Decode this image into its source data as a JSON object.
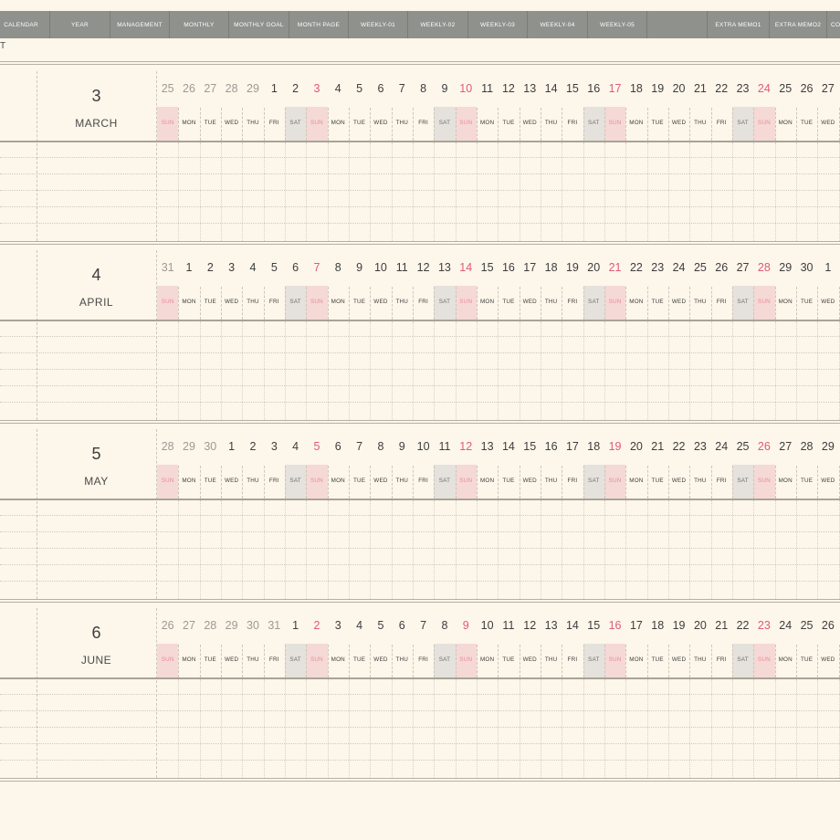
{
  "nav": {
    "tabs": [
      {
        "label": "CALENDAR"
      },
      {
        "label": "YEAR"
      },
      {
        "label": "MANAGEMENT"
      },
      {
        "label": "MONTHLY"
      },
      {
        "label": "MONTHLY GOAL"
      },
      {
        "label": "MONTH PAGE"
      },
      {
        "label": "WEEKLY-01"
      },
      {
        "label": "WEEKLY-02"
      },
      {
        "label": "WEEKLY-03"
      },
      {
        "label": "WEEKLY-04"
      },
      {
        "label": "WEEKLY-05"
      },
      {
        "label": ""
      },
      {
        "label": "EXTRA MEMO1"
      },
      {
        "label": "EXTRA MEMO2"
      },
      {
        "label": "CO"
      }
    ]
  },
  "page": {
    "title_fragment": "T"
  },
  "months": [
    {
      "number": "3",
      "name": "MARCH",
      "dates": [
        "25",
        "26",
        "27",
        "28",
        "29",
        "1",
        "2",
        "3",
        "4",
        "5",
        "6",
        "7",
        "8",
        "9",
        "10",
        "11",
        "12",
        "13",
        "14",
        "15",
        "16",
        "17",
        "18",
        "19",
        "20",
        "21",
        "22",
        "23",
        "24",
        "25",
        "26",
        "27"
      ],
      "weekdays": [
        "SUN",
        "MON",
        "TUE",
        "WED",
        "THU",
        "FRI",
        "SAT",
        "SUN",
        "MON",
        "TUE",
        "WED",
        "THU",
        "FRI",
        "SAT",
        "SUN",
        "MON",
        "TUE",
        "WED",
        "THU",
        "FRI",
        "SAT",
        "SUN",
        "MON",
        "TUE",
        "WED",
        "THU",
        "FRI",
        "SAT",
        "SUN",
        "MON",
        "TUE",
        "WED"
      ],
      "leading_other": 5
    },
    {
      "number": "4",
      "name": "APRIL",
      "dates": [
        "31",
        "1",
        "2",
        "3",
        "4",
        "5",
        "6",
        "7",
        "8",
        "9",
        "10",
        "11",
        "12",
        "13",
        "14",
        "15",
        "16",
        "17",
        "18",
        "19",
        "20",
        "21",
        "22",
        "23",
        "24",
        "25",
        "26",
        "27",
        "28",
        "29",
        "30",
        "1"
      ],
      "weekdays": [
        "SUN",
        "MON",
        "TUE",
        "WED",
        "THU",
        "FRI",
        "SAT",
        "SUN",
        "MON",
        "TUE",
        "WED",
        "THU",
        "FRI",
        "SAT",
        "SUN",
        "MON",
        "TUE",
        "WED",
        "THU",
        "FRI",
        "SAT",
        "SUN",
        "MON",
        "TUE",
        "WED",
        "THU",
        "FRI",
        "SAT",
        "SUN",
        "MON",
        "TUE",
        "WED"
      ],
      "leading_other": 1
    },
    {
      "number": "5",
      "name": "MAY",
      "dates": [
        "28",
        "29",
        "30",
        "1",
        "2",
        "3",
        "4",
        "5",
        "6",
        "7",
        "8",
        "9",
        "10",
        "11",
        "12",
        "13",
        "14",
        "15",
        "16",
        "17",
        "18",
        "19",
        "20",
        "21",
        "22",
        "23",
        "24",
        "25",
        "26",
        "27",
        "28",
        "29"
      ],
      "weekdays": [
        "SUN",
        "MON",
        "TUE",
        "WED",
        "THU",
        "FRI",
        "SAT",
        "SUN",
        "MON",
        "TUE",
        "WED",
        "THU",
        "FRI",
        "SAT",
        "SUN",
        "MON",
        "TUE",
        "WED",
        "THU",
        "FRI",
        "SAT",
        "SUN",
        "MON",
        "TUE",
        "WED",
        "THU",
        "FRI",
        "SAT",
        "SUN",
        "MON",
        "TUE",
        "WED"
      ],
      "leading_other": 3
    },
    {
      "number": "6",
      "name": "JUNE",
      "dates": [
        "26",
        "27",
        "28",
        "29",
        "30",
        "31",
        "1",
        "2",
        "3",
        "4",
        "5",
        "6",
        "7",
        "8",
        "9",
        "10",
        "11",
        "12",
        "13",
        "14",
        "15",
        "16",
        "17",
        "18",
        "19",
        "20",
        "21",
        "22",
        "23",
        "24",
        "25",
        "26"
      ],
      "weekdays": [
        "SUN",
        "MON",
        "TUE",
        "WED",
        "THU",
        "FRI",
        "SAT",
        "SUN",
        "MON",
        "TUE",
        "WED",
        "THU",
        "FRI",
        "SAT",
        "SUN",
        "MON",
        "TUE",
        "WED",
        "THU",
        "FRI",
        "SAT",
        "SUN",
        "MON",
        "TUE",
        "WED",
        "THU",
        "FRI",
        "SAT",
        "SUN",
        "MON",
        "TUE",
        "WED"
      ],
      "leading_other": 6
    }
  ],
  "colors": {
    "background": "#fdf6ea",
    "nav_bar": "#8f918d",
    "sunday_fill": "#f5d9d6",
    "saturday_fill": "#e5e2dd",
    "sunday_text": "#e05a76"
  }
}
